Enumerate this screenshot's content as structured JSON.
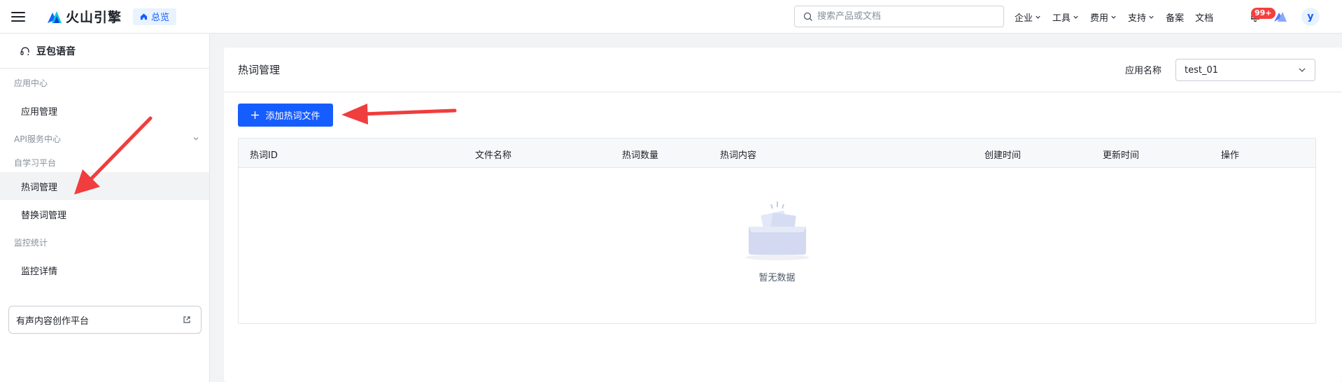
{
  "header": {
    "brand": "火山引擎",
    "overview_label": "总览",
    "search_placeholder": "搜索产品或文档",
    "nav": [
      {
        "label": "企业"
      },
      {
        "label": "工具"
      },
      {
        "label": "费用"
      },
      {
        "label": "支持"
      },
      {
        "label": "备案"
      },
      {
        "label": "文档"
      }
    ],
    "notification_badge": "99+",
    "avatar_initial": "y"
  },
  "sidebar": {
    "product_title": "豆包语音",
    "group_app_center": "应用中心",
    "item_app_manage": "应用管理",
    "group_api_center": "API服务中心",
    "group_self_learning": "自学习平台",
    "item_hotword_manage": "热词管理",
    "item_replace_manage": "替换词管理",
    "group_monitor": "监控统计",
    "item_monitor_detail": "监控详情",
    "external_link": "有声内容创作平台"
  },
  "main": {
    "title": "热词管理",
    "app_name_label": "应用名称",
    "app_name_value": "test_01",
    "add_button": "添加热词文件",
    "table": {
      "columns": [
        "热词ID",
        "文件名称",
        "热词数量",
        "热词内容",
        "创建时间",
        "更新时间",
        "操作"
      ],
      "empty_text": "暂无数据"
    }
  },
  "colors": {
    "primary": "#165dff",
    "annotation_arrow": "#f03d3d",
    "badge": "#f53f3f"
  }
}
